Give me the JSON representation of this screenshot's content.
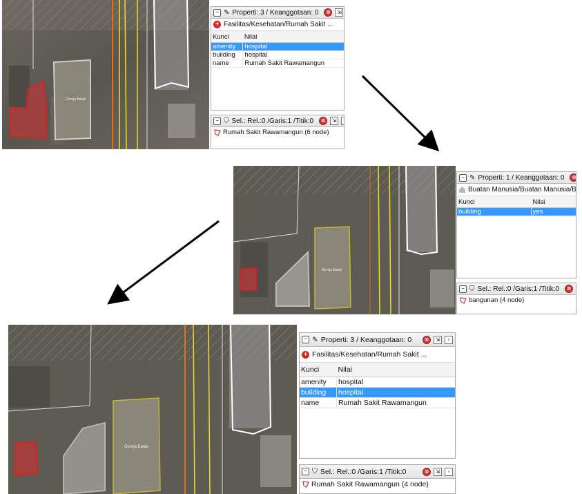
{
  "shots": [
    {
      "properties_title": "Properti: 3 / Keanggotaan: 0",
      "preset": "Fasilitas/Kesehatan/Rumah Sakit ...",
      "preset_icon": "hospital-plus-icon",
      "col_key": "Kunci",
      "col_value": "Nilai",
      "tags": [
        {
          "key": "amenity",
          "value": "hospital",
          "selected": true
        },
        {
          "key": "building",
          "value": "hospital",
          "selected": false
        },
        {
          "key": "name",
          "value": "Rumah Sakit Rawamangun",
          "selected": false
        }
      ],
      "selection_title": "Sel.: Rel.:0 /Garis:1 /Titik:0",
      "selection_item": "Rumah Sakit Rawamangun (6 node)",
      "map_label": "Gereja Batak"
    },
    {
      "properties_title": "Properti: 1 / Keanggotaan: 0",
      "preset": "Buatan Manusia/Buatan Manusia/Bangunan ...",
      "preset_icon": "building-icon",
      "col_key": "Kunci",
      "col_value": "Nilai",
      "tags": [
        {
          "key": "building",
          "value": "yes",
          "selected": true
        }
      ],
      "selection_title": "Sel.: Rel.:0 /Garis:1 /Titik:0",
      "selection_item": "bangunan (4 node)",
      "map_label": "Gereja Batak"
    },
    {
      "properties_title": "Properti: 3 / Keanggotaan: 0",
      "preset": "Fasilitas/Kesehatan/Rumah Sakit ...",
      "preset_icon": "hospital-plus-icon",
      "col_key": "Kunci",
      "col_value": "Nilai",
      "tags": [
        {
          "key": "amenity",
          "value": "hospital",
          "selected": false
        },
        {
          "key": "building",
          "value": "hospital",
          "selected": true
        },
        {
          "key": "name",
          "value": "Rumah Sakit Rawamangun",
          "selected": false
        }
      ],
      "selection_title": "Sel.: Rel.:0 /Garis:1 /Titik:0",
      "selection_item": "Rumah Sakit Rawamangun (4 node)",
      "map_label": "Gereja Batak"
    }
  ],
  "colors": {
    "selected_row": "#3399ff",
    "selected_way": "#e02020",
    "way_yellow": "#f0e020",
    "way_white": "#ffffff",
    "road_orange": "#e07020",
    "arrow": "#000000"
  }
}
